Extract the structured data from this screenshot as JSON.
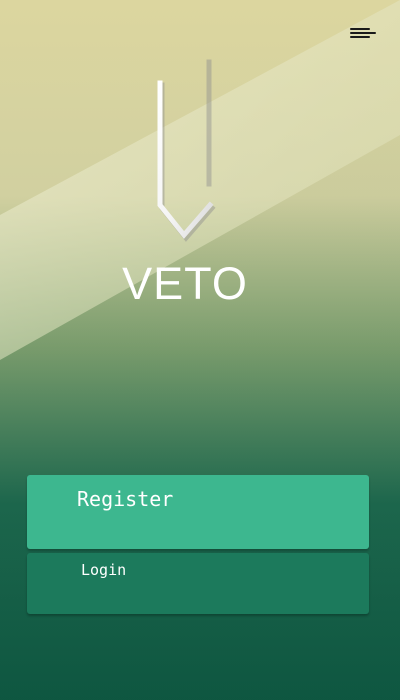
{
  "app": {
    "title": "VETO",
    "theme": {
      "gradient_top": "#d9d49b",
      "gradient_bottom": "#0f5b44",
      "primary_button": "#3db78f",
      "secondary_button": "#1c7a5c",
      "text": "#ffffff"
    }
  },
  "header": {
    "menu_icon": "hamburger-menu-icon"
  },
  "logo": {
    "icon": "arrow-down-icon"
  },
  "actions": {
    "register_label": "Register",
    "login_label": "Login"
  }
}
